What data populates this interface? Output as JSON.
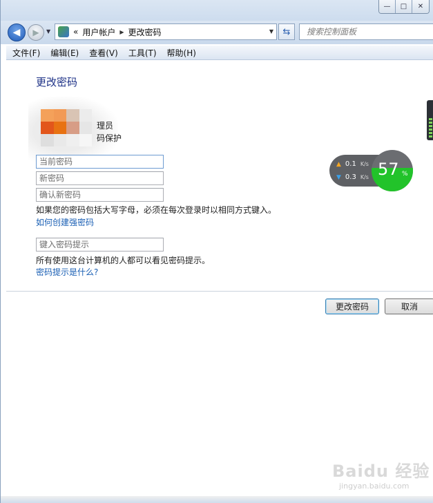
{
  "nav": {
    "address_prefix": "«",
    "breadcrumb": [
      "用户帐户",
      "更改密码"
    ],
    "search_placeholder": "搜索控制面板"
  },
  "menu": [
    "文件(F)",
    "编辑(E)",
    "查看(V)",
    "工具(T)",
    "帮助(H)"
  ],
  "page": {
    "title": "更改密码",
    "user_role": "理员",
    "user_protection": "码保护",
    "current_password_placeholder": "当前密码",
    "new_password_placeholder": "新密码",
    "confirm_password_placeholder": "确认新密码",
    "caps_note": "如果您的密码包括大写字母，必须在每次登录时以相同方式键入。",
    "strong_password_link": "如何创建强密码",
    "hint_placeholder": "键入密码提示",
    "hint_note": "所有使用这台计算机的人都可以看见密码提示。",
    "hint_link": "密码提示是什么?"
  },
  "buttons": {
    "change": "更改密码",
    "cancel": "取消"
  },
  "speed_widget": {
    "up_value": "0.1",
    "down_value": "0.3",
    "unit": "K/s",
    "usage_percent": "57",
    "pct_sign": "%",
    "fill_color": "#22c32a"
  },
  "watermark": {
    "brand": "Baidu 经验",
    "url": "jingyan.baidu.com"
  },
  "colors": {
    "link": "#1a5fb4",
    "title": "#1e3287",
    "default_button_border": "#3c7fb1"
  }
}
